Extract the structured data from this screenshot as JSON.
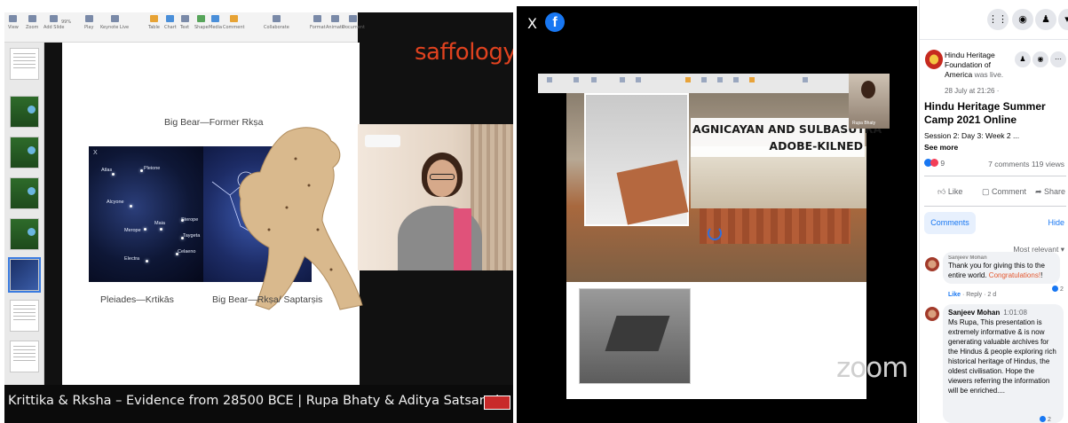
{
  "left": {
    "brand": "saffology",
    "caption": "Krittika & Rksha – Evidence from 28500 BCE | Rupa Bhaty & Aditya Satsangi",
    "toolbar": [
      "View",
      "Zoom",
      "Add Slide",
      "Play",
      "Keynote Live",
      "Table",
      "Chart",
      "Text",
      "Shape",
      "Media",
      "Comment",
      "Collaborate",
      "Format",
      "Animate",
      "Document"
    ],
    "zoom": "99%",
    "slide": {
      "top_label": "Big Bear—Former Rkṣa",
      "left_caption": "Pleiades—Krtikās",
      "right_caption": "Big Bear—Rkṣa/ Saptarṣis",
      "close_x": "X",
      "stars": [
        "Atlas",
        "Pleione",
        "Alcyone",
        "Merope",
        "Maia",
        "Sterope",
        "Taygeta",
        "Celaeno",
        "Electra"
      ]
    }
  },
  "mid": {
    "close": "X",
    "fb_glyph": "f",
    "slide_title_line1": "AGNICAYAN AND SULBASUTRA",
    "slide_title_line2": "ADOBE-KILNED",
    "cam_name": "Rupa Bhaty",
    "watermark": "zoom"
  },
  "right": {
    "page_name": "Hindu Heritage Foundation of America",
    "was_live": "was live.",
    "date": "28 July at 21:26 ·",
    "post_title": "Hindu Heritage Summer Camp 2021 Online",
    "session": "Session 2: Day 3: Week 2 ...",
    "see_more": "See more",
    "reaction_count": "9",
    "comments_views": "7 comments 119 views",
    "like": "Like",
    "comment": "Comment",
    "share": "Share",
    "tab_comments": "Comments",
    "hide": "Hide",
    "most_relevant": "Most relevant ▾",
    "comment1": {
      "author": "Sanjeev Mohan",
      "text_a": "Thank you for giving this to the entire world. ",
      "text_b": "Congratulations!",
      "text_c": "!",
      "like": "Like",
      "reply": "Reply",
      "age": "2 d",
      "likes": "2"
    },
    "comment2": {
      "author": "Sanjeev Mohan",
      "time": "1:01:08",
      "text": "Ms Rupa, This presentation is extremely informative & is now generating valuable archives for the Hindus & people exploring rich historical heritage of Hindus, the oldest civilisation. Hope the viewers referring the information will be enriched....",
      "likes": "2"
    }
  }
}
